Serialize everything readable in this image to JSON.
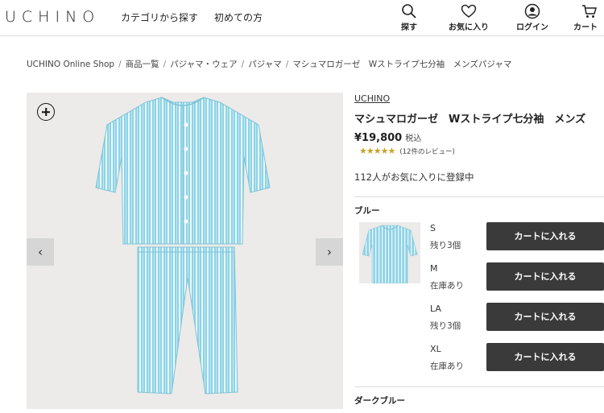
{
  "header": {
    "logo": "UCHINO",
    "nav": [
      "カテゴリから探す",
      "初めての方"
    ],
    "buttons": {
      "search": "探す",
      "favorites": "お気に入り",
      "login": "ログイン",
      "cart": "カート"
    }
  },
  "breadcrumb": [
    "UCHINO Online Shop",
    "商品一覧",
    "パジャマ・ウェア",
    "パジャマ",
    "マシュマロガーゼ　Wストライプ七分袖　メンズパジャマ"
  ],
  "product": {
    "brand": "UCHINO",
    "title": "マシュマロガーゼ　Wストライプ七分袖　メンズ",
    "price": "¥19,800",
    "tax_label": "税込",
    "rating": 4.5,
    "stars": "★★★★★",
    "review_count": "(12件のレビュー)",
    "favorite_text": "112人がお気に入りに登録中"
  },
  "variants": [
    {
      "color": "ブルー",
      "sizes": [
        {
          "size": "S",
          "stock": "残り3個",
          "button": "カートに入れる"
        },
        {
          "size": "M",
          "stock": "在庫あり",
          "button": "カートに入れる"
        },
        {
          "size": "LA",
          "stock": "残り3個",
          "button": "カートに入れる"
        },
        {
          "size": "XL",
          "stock": "在庫あり",
          "button": "カートに入れる"
        }
      ]
    },
    {
      "color": "ダークブルー",
      "sizes": []
    }
  ],
  "colors": {
    "pajama_base": "#8fd3e6",
    "pajama_stripe": "#eaf7fb",
    "button_bg": "#3a3a3a",
    "star": "#c9a227"
  }
}
